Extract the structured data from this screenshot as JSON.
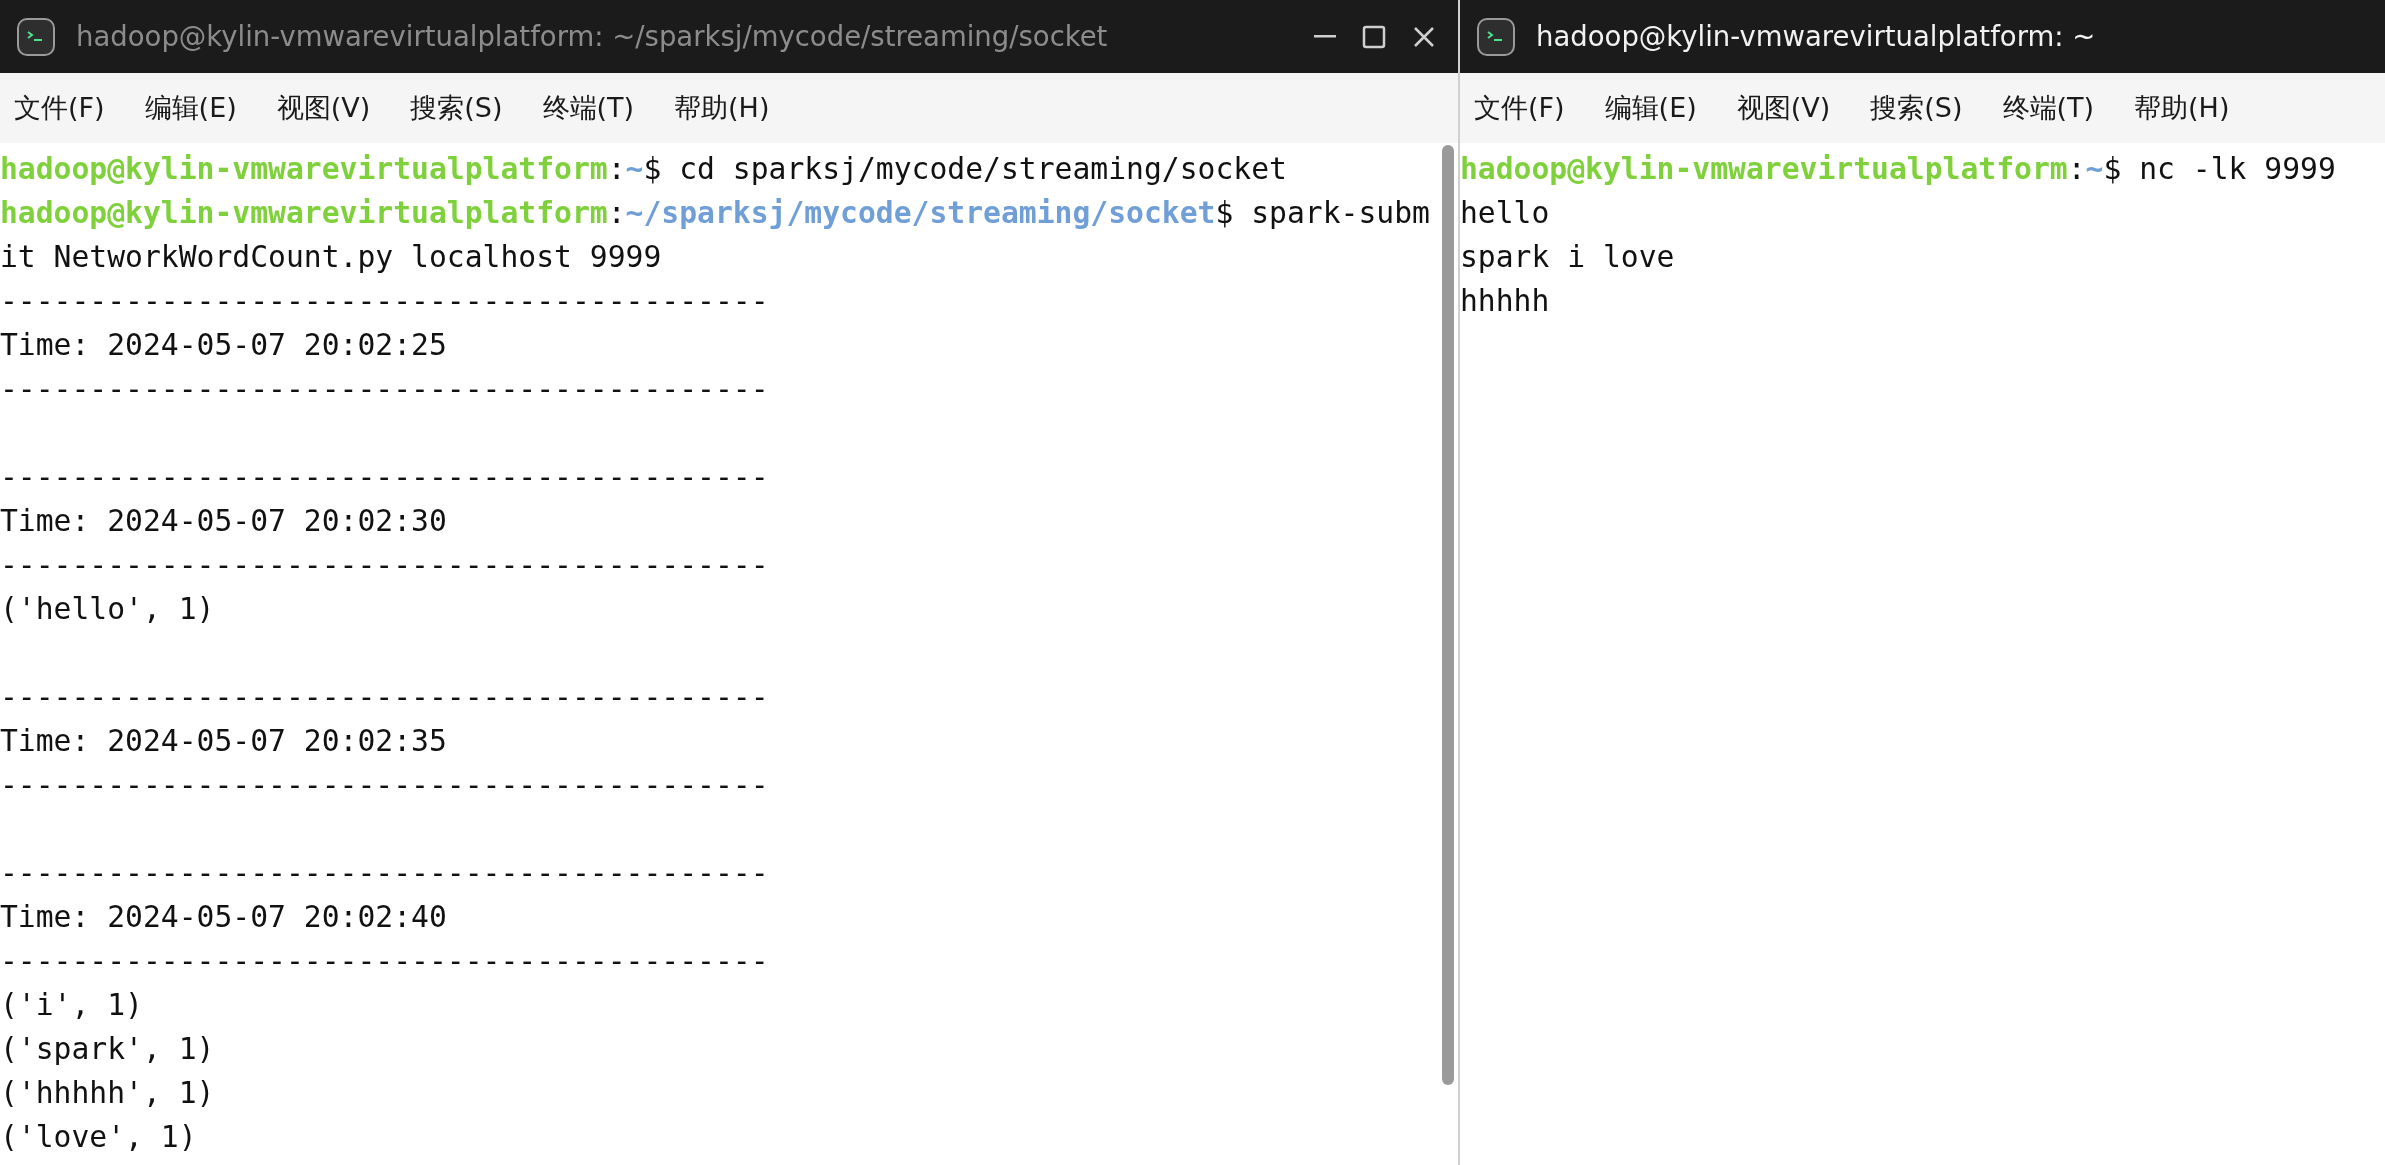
{
  "windows": [
    {
      "title": "hadoop@kylin-vmwarevirtualplatform: ~/sparksj/mycode/streaming/socket",
      "active": false,
      "controls": true,
      "scrollbar": true,
      "menu": [
        "文件(F)",
        "编辑(E)",
        "视图(V)",
        "搜索(S)",
        "终端(T)",
        "帮助(H)"
      ],
      "lines": [
        {
          "kind": "text",
          "segments": [
            {
              "kind": "user",
              "text": "hadoop@kylin-vmwarevirtualplatform"
            },
            {
              "kind": "plain",
              "text": ":"
            },
            {
              "kind": "path",
              "text": "~"
            },
            {
              "kind": "plain",
              "text": "$ cd sparksj/mycode/streaming/socket"
            }
          ]
        },
        {
          "kind": "text",
          "segments": [
            {
              "kind": "user",
              "text": "hadoop@kylin-vmwarevirtualplatform"
            },
            {
              "kind": "plain",
              "text": ":"
            },
            {
              "kind": "path",
              "text": "~/sparksj/mycode/streaming/socket"
            },
            {
              "kind": "plain",
              "text": "$ spark-subm"
            }
          ]
        },
        {
          "kind": "text",
          "segments": [
            {
              "kind": "plain",
              "text": "it NetworkWordCount.py localhost 9999"
            }
          ]
        },
        {
          "kind": "text",
          "segments": [
            {
              "kind": "plain",
              "text": "-------------------------------------------"
            }
          ]
        },
        {
          "kind": "text",
          "segments": [
            {
              "kind": "plain",
              "text": "Time: 2024-05-07 20:02:25"
            }
          ]
        },
        {
          "kind": "text",
          "segments": [
            {
              "kind": "plain",
              "text": "-------------------------------------------"
            }
          ]
        },
        {
          "kind": "blank"
        },
        {
          "kind": "text",
          "segments": [
            {
              "kind": "plain",
              "text": "-------------------------------------------"
            }
          ]
        },
        {
          "kind": "text",
          "segments": [
            {
              "kind": "plain",
              "text": "Time: 2024-05-07 20:02:30"
            }
          ]
        },
        {
          "kind": "text",
          "segments": [
            {
              "kind": "plain",
              "text": "-------------------------------------------"
            }
          ]
        },
        {
          "kind": "text",
          "segments": [
            {
              "kind": "plain",
              "text": "('hello', 1)"
            }
          ]
        },
        {
          "kind": "blank"
        },
        {
          "kind": "text",
          "segments": [
            {
              "kind": "plain",
              "text": "-------------------------------------------"
            }
          ]
        },
        {
          "kind": "text",
          "segments": [
            {
              "kind": "plain",
              "text": "Time: 2024-05-07 20:02:35"
            }
          ]
        },
        {
          "kind": "text",
          "segments": [
            {
              "kind": "plain",
              "text": "-------------------------------------------"
            }
          ]
        },
        {
          "kind": "blank"
        },
        {
          "kind": "text",
          "segments": [
            {
              "kind": "plain",
              "text": "-------------------------------------------"
            }
          ]
        },
        {
          "kind": "text",
          "segments": [
            {
              "kind": "plain",
              "text": "Time: 2024-05-07 20:02:40"
            }
          ]
        },
        {
          "kind": "text",
          "segments": [
            {
              "kind": "plain",
              "text": "-------------------------------------------"
            }
          ]
        },
        {
          "kind": "text",
          "segments": [
            {
              "kind": "plain",
              "text": "('i', 1)"
            }
          ]
        },
        {
          "kind": "text",
          "segments": [
            {
              "kind": "plain",
              "text": "('spark', 1)"
            }
          ]
        },
        {
          "kind": "text",
          "segments": [
            {
              "kind": "plain",
              "text": "('hhhhh', 1)"
            }
          ]
        },
        {
          "kind": "text",
          "segments": [
            {
              "kind": "plain",
              "text": "('love', 1)"
            }
          ]
        }
      ]
    },
    {
      "title": "hadoop@kylin-vmwarevirtualplatform: ~",
      "active": true,
      "controls": false,
      "scrollbar": false,
      "menu": [
        "文件(F)",
        "编辑(E)",
        "视图(V)",
        "搜索(S)",
        "终端(T)",
        "帮助(H)"
      ],
      "lines": [
        {
          "kind": "text",
          "segments": [
            {
              "kind": "user",
              "text": "hadoop@kylin-vmwarevirtualplatform"
            },
            {
              "kind": "plain",
              "text": ":"
            },
            {
              "kind": "path",
              "text": "~"
            },
            {
              "kind": "plain",
              "text": "$ nc -lk 9999"
            }
          ]
        },
        {
          "kind": "text",
          "segments": [
            {
              "kind": "plain",
              "text": "hello"
            }
          ]
        },
        {
          "kind": "text",
          "segments": [
            {
              "kind": "plain",
              "text": "spark i love"
            }
          ]
        },
        {
          "kind": "text",
          "segments": [
            {
              "kind": "plain",
              "text": "hhhhh"
            }
          ]
        }
      ]
    }
  ]
}
